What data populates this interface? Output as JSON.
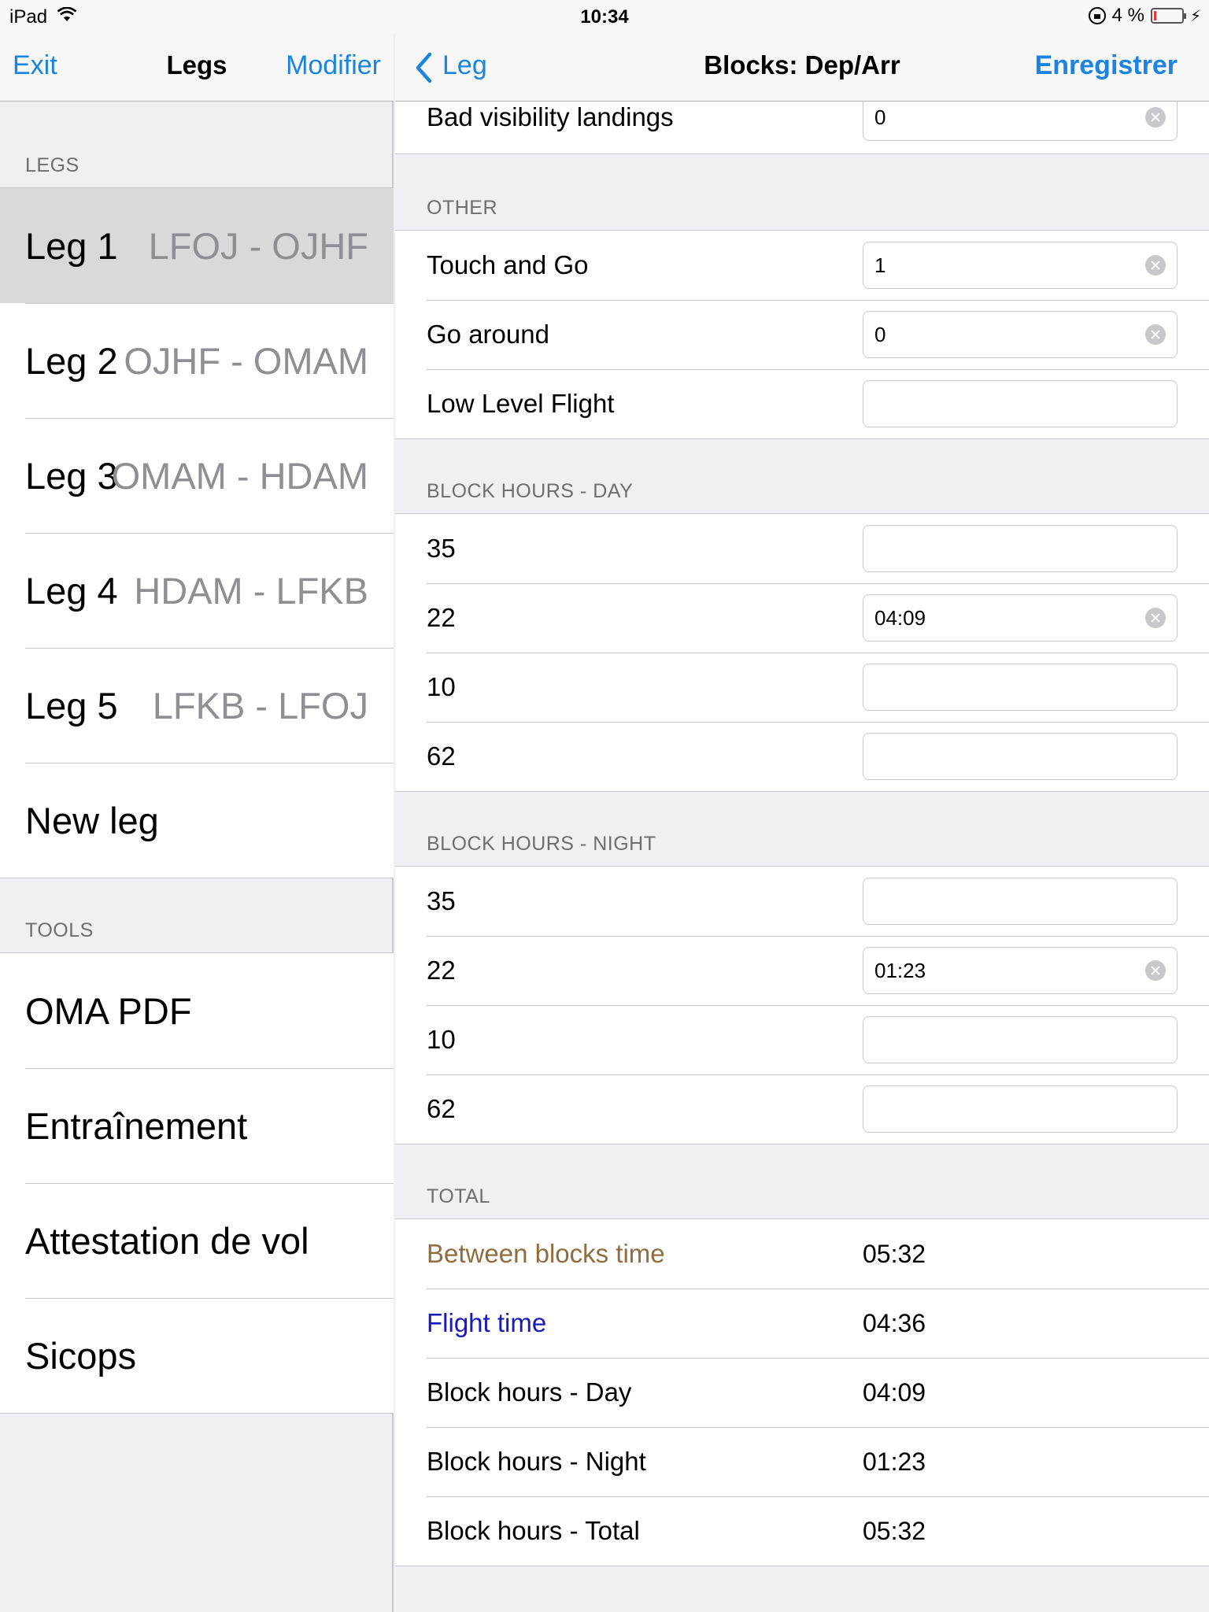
{
  "status": {
    "device": "iPad",
    "time": "10:34",
    "battery": "4 %"
  },
  "master": {
    "nav": {
      "left": "Exit",
      "title": "Legs",
      "right": "Modifier"
    },
    "legs_header": "LEGS",
    "legs": [
      {
        "name": "Leg 1",
        "route": "LFOJ - OJHF"
      },
      {
        "name": "Leg 2",
        "route": "OJHF - OMAM"
      },
      {
        "name": "Leg 3",
        "route": "OMAM - HDAM"
      },
      {
        "name": "Leg 4",
        "route": "HDAM - LFKB"
      },
      {
        "name": "Leg 5",
        "route": "LFKB - LFOJ"
      }
    ],
    "new_leg": "New leg",
    "tools_header": "TOOLS",
    "tools": [
      "OMA PDF",
      "Entraînement",
      "Attestation de vol",
      "Sicops"
    ]
  },
  "detail": {
    "nav": {
      "back": "Leg",
      "title": "Blocks: Dep/Arr",
      "save": "Enregistrer"
    },
    "top_row": {
      "label": "Bad visibility landings",
      "value": "0"
    },
    "other": {
      "header": "OTHER",
      "rows": [
        {
          "label": "Touch and Go",
          "value": "1"
        },
        {
          "label": "Go around",
          "value": "0"
        },
        {
          "label": "Low Level Flight",
          "value": ""
        }
      ]
    },
    "day": {
      "header": "BLOCK HOURS - DAY",
      "rows": [
        {
          "label": "35",
          "value": ""
        },
        {
          "label": "22",
          "value": "04:09"
        },
        {
          "label": "10",
          "value": ""
        },
        {
          "label": "62",
          "value": ""
        }
      ]
    },
    "night": {
      "header": "BLOCK HOURS - NIGHT",
      "rows": [
        {
          "label": "35",
          "value": ""
        },
        {
          "label": "22",
          "value": "01:23"
        },
        {
          "label": "10",
          "value": ""
        },
        {
          "label": "62",
          "value": ""
        }
      ]
    },
    "total": {
      "header": "TOTAL",
      "rows": [
        {
          "label": "Between blocks time",
          "value": "05:32"
        },
        {
          "label": "Flight time",
          "value": "04:36"
        },
        {
          "label": "Block hours - Day",
          "value": "04:09"
        },
        {
          "label": "Block hours - Night",
          "value": "01:23"
        },
        {
          "label": "Block hours - Total",
          "value": "05:32"
        }
      ]
    }
  },
  "colors": {
    "accent": "#1a84e0",
    "between_blocks": "#8f6d3f",
    "flight_time": "#1a1ab8"
  }
}
